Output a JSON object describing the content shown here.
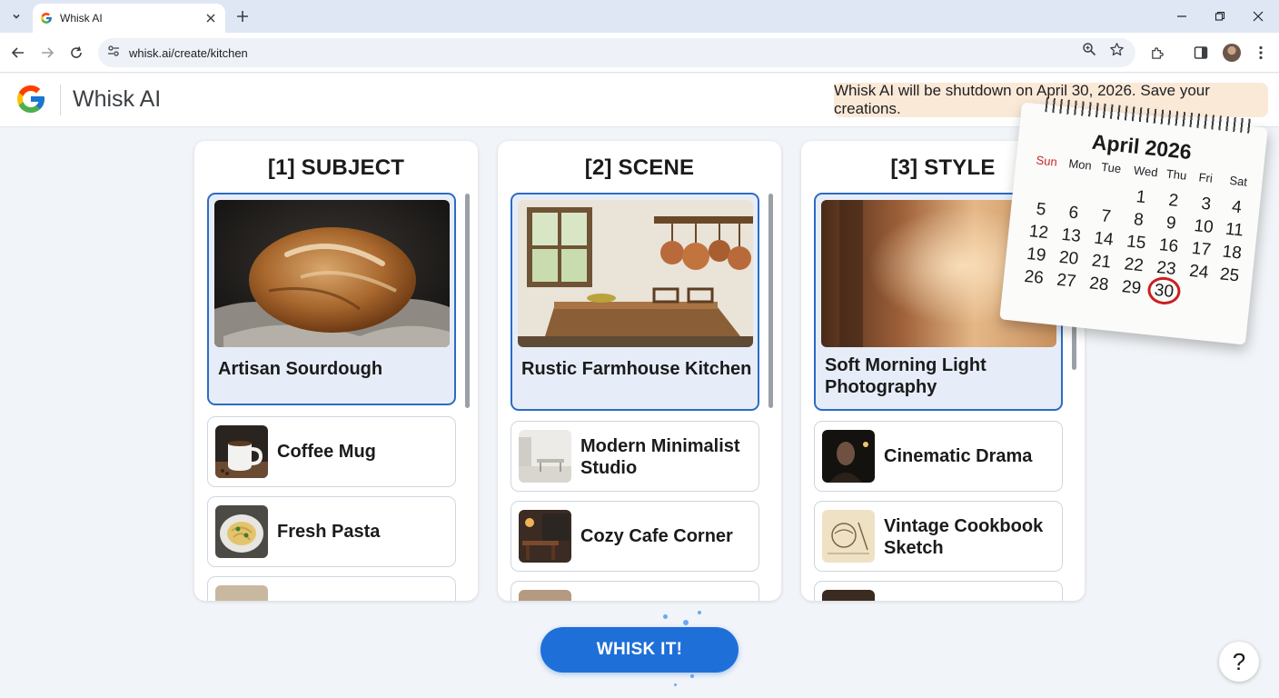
{
  "browser": {
    "tab_title": "Whisk AI",
    "url": "whisk.ai/create/kitchen",
    "icons": [
      "tab-dropdown-icon",
      "google-favicon",
      "close-tab-icon",
      "new-tab-icon",
      "minimize-icon",
      "restore-icon",
      "close-window-icon",
      "back-icon",
      "forward-icon",
      "reload-icon",
      "site-info-icon",
      "zoom-icon",
      "bookmark-star-icon",
      "extensions-icon",
      "side-panel-icon",
      "profile-avatar",
      "menu-icon"
    ]
  },
  "app": {
    "title": "Whisk AI",
    "banner": "Whisk AI will be shutdown on April 30, 2026. Save your creations."
  },
  "columns": [
    {
      "title": "[1] SUBJECT",
      "selected": "Artisan Sourdough",
      "items": [
        "Coffee Mug",
        "Fresh Pasta"
      ]
    },
    {
      "title": "[2] SCENE",
      "selected": "Rustic Farmhouse Kitchen",
      "items": [
        "Modern Minimalist Studio",
        "Cozy Cafe Corner"
      ]
    },
    {
      "title": "[3] STYLE",
      "selected": "Soft Morning Light Photography",
      "items": [
        "Cinematic Drama",
        "Vintage Cookbook Sketch"
      ]
    }
  ],
  "calendar": {
    "month": "April 2026",
    "weekdays": [
      "Sun",
      "Mon",
      "Tue",
      "Wed",
      "Thu",
      "Fri",
      "Sat"
    ],
    "days": [
      "1",
      "2",
      "3",
      "4",
      "5",
      "6",
      "7",
      "8",
      "9",
      "10",
      "11",
      "12",
      "13",
      "14",
      "15",
      "16",
      "17",
      "18",
      "19",
      "20",
      "21",
      "22",
      "23",
      "24",
      "25",
      "26",
      "27",
      "28",
      "29",
      "30"
    ],
    "highlighted_day": "30",
    "highlight_color": "#cc1f1f"
  },
  "actions": {
    "whisk_label": "WHISK IT!",
    "help_label": "?"
  },
  "colors": {
    "accent": "#1f6fd8",
    "selected_border": "#2d6bc4",
    "selected_bg": "#e6edf9",
    "banner_bg": "#fbe9d7"
  }
}
